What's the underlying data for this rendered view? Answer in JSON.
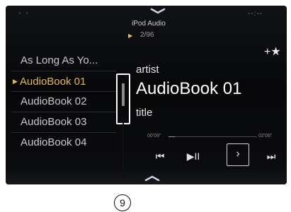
{
  "header": {
    "source": "iPod Audio",
    "track_counter": "2/96",
    "clock": "--:--",
    "dots": "• •"
  },
  "list": {
    "items": [
      {
        "label": "As Long As Yo..."
      },
      {
        "label": "AudioBook 01",
        "active": true
      },
      {
        "label": "AudioBook 02"
      },
      {
        "label": "AudioBook 03"
      },
      {
        "label": "AudioBook 04"
      }
    ]
  },
  "now_playing": {
    "artist": "artist",
    "album": "AudioBook 01",
    "title": "title",
    "time_elapsed": "00'09\"",
    "time_total": "02'06\"",
    "progress_fraction": 0.07
  },
  "controls": {
    "prev": "⏮",
    "play_pause": "▶II",
    "next_page": "›",
    "next": "⏭",
    "favorite": "+★"
  },
  "callout": {
    "number": "9"
  },
  "colors": {
    "accent": "#e6b84a",
    "background": "#0a0b0e"
  }
}
